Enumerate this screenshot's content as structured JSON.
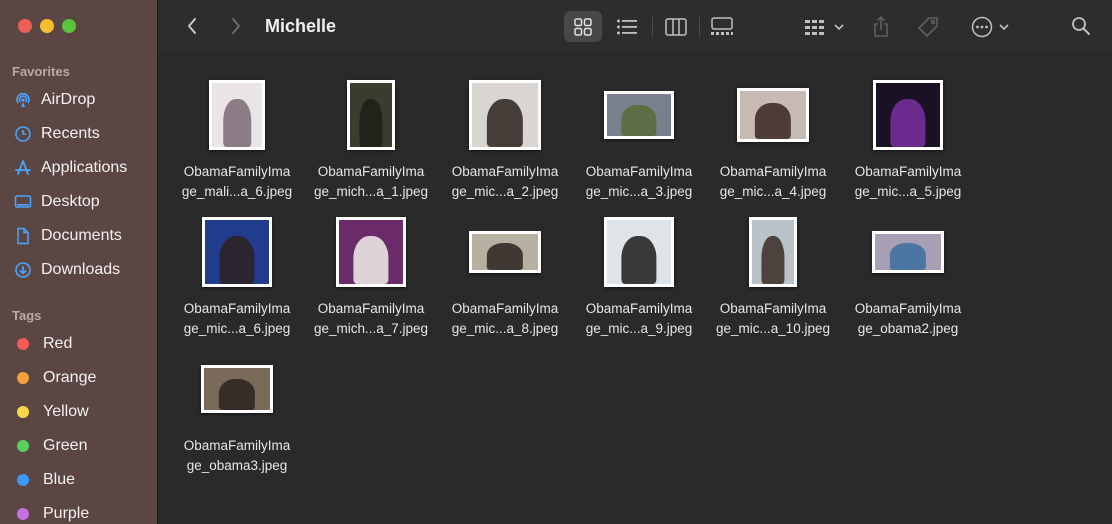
{
  "window": {
    "title": "Michelle"
  },
  "traffic_lights": {
    "close": "#ee5f57",
    "minimize": "#f5bd30",
    "zoom": "#5ac43f"
  },
  "sidebar": {
    "favorites_label": "Favorites",
    "favorites": [
      {
        "label": "AirDrop",
        "icon": "airdrop-icon"
      },
      {
        "label": "Recents",
        "icon": "clock-icon"
      },
      {
        "label": "Applications",
        "icon": "applications-icon"
      },
      {
        "label": "Desktop",
        "icon": "desktop-icon"
      },
      {
        "label": "Documents",
        "icon": "document-icon"
      },
      {
        "label": "Downloads",
        "icon": "download-icon"
      }
    ],
    "tags_label": "Tags",
    "tags": [
      {
        "label": "Red",
        "color": "#f25a55"
      },
      {
        "label": "Orange",
        "color": "#f6a23b"
      },
      {
        "label": "Yellow",
        "color": "#f7d84a"
      },
      {
        "label": "Green",
        "color": "#5bcf5d"
      },
      {
        "label": "Blue",
        "color": "#3b99f3"
      },
      {
        "label": "Purple",
        "color": "#c86fe0"
      }
    ]
  },
  "toolbar": {
    "icons": [
      "back-icon",
      "forward-icon",
      "icon-view-icon",
      "list-view-icon",
      "column-view-icon",
      "gallery-view-icon",
      "group-icon",
      "share-icon",
      "tag-icon",
      "more-icon",
      "search-icon"
    ]
  },
  "files": [
    {
      "line1": "ObamaFamilyIma",
      "line2": "ge_mali...a_6.jpeg",
      "bg": "#e9e4e6",
      "fg": "#7a6a74"
    },
    {
      "line1": "ObamaFamilyIma",
      "line2": "ge_mich...a_1.jpeg",
      "bg": "#3a3d2e",
      "fg": "#1d1d16"
    },
    {
      "line1": "ObamaFamilyIma",
      "line2": "ge_mic...a_2.jpeg",
      "bg": "#d9d6d2",
      "fg": "#2b211d"
    },
    {
      "line1": "ObamaFamilyIma",
      "line2": "ge_mic...a_3.jpeg",
      "bg": "#7a7f8e",
      "fg": "#5a6a38"
    },
    {
      "line1": "ObamaFamilyIma",
      "line2": "ge_mic...a_4.jpeg",
      "bg": "#c7b9b4",
      "fg": "#3b2620"
    },
    {
      "line1": "ObamaFamilyIma",
      "line2": "ge_mic...a_5.jpeg",
      "bg": "#1a1224",
      "fg": "#7a2fa0"
    },
    {
      "line1": "ObamaFamilyIma",
      "line2": "ge_mic...a_6.jpeg",
      "bg": "#1f3d8c",
      "fg": "#2d211d"
    },
    {
      "line1": "ObamaFamilyIma",
      "line2": "ge_mich...a_7.jpeg",
      "bg": "#6b2b6a",
      "fg": "#f2f0ec"
    },
    {
      "line1": "ObamaFamilyIma",
      "line2": "ge_mic...a_8.jpeg",
      "bg": "#b6b0a0",
      "fg": "#2c2420"
    },
    {
      "line1": "ObamaFamilyIma",
      "line2": "ge_mic...a_9.jpeg",
      "bg": "#dfe4e8",
      "fg": "#1e1a1a"
    },
    {
      "line1": "ObamaFamilyIma",
      "line2": "ge_mic...a_10.jpeg",
      "bg": "#b9c2c9",
      "fg": "#3a2b26"
    },
    {
      "line1": "ObamaFamilyIma",
      "line2": "ge_obama2.jpeg",
      "bg": "#a7a0b5",
      "fg": "#3b6ea0"
    },
    {
      "line1": "ObamaFamilyIma",
      "line2": "ge_obama3.jpeg",
      "bg": "#7a6a5a",
      "fg": "#2a2220"
    }
  ]
}
